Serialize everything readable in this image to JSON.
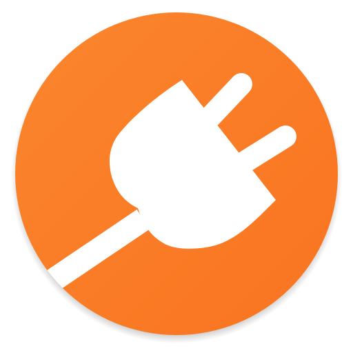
{
  "icon": {
    "name": "plug-icon",
    "colors": {
      "background_light": "#FB862D",
      "background_dark": "#F97320",
      "glyph": "#FFFFFF",
      "shadow": "#9A9A9A"
    }
  }
}
